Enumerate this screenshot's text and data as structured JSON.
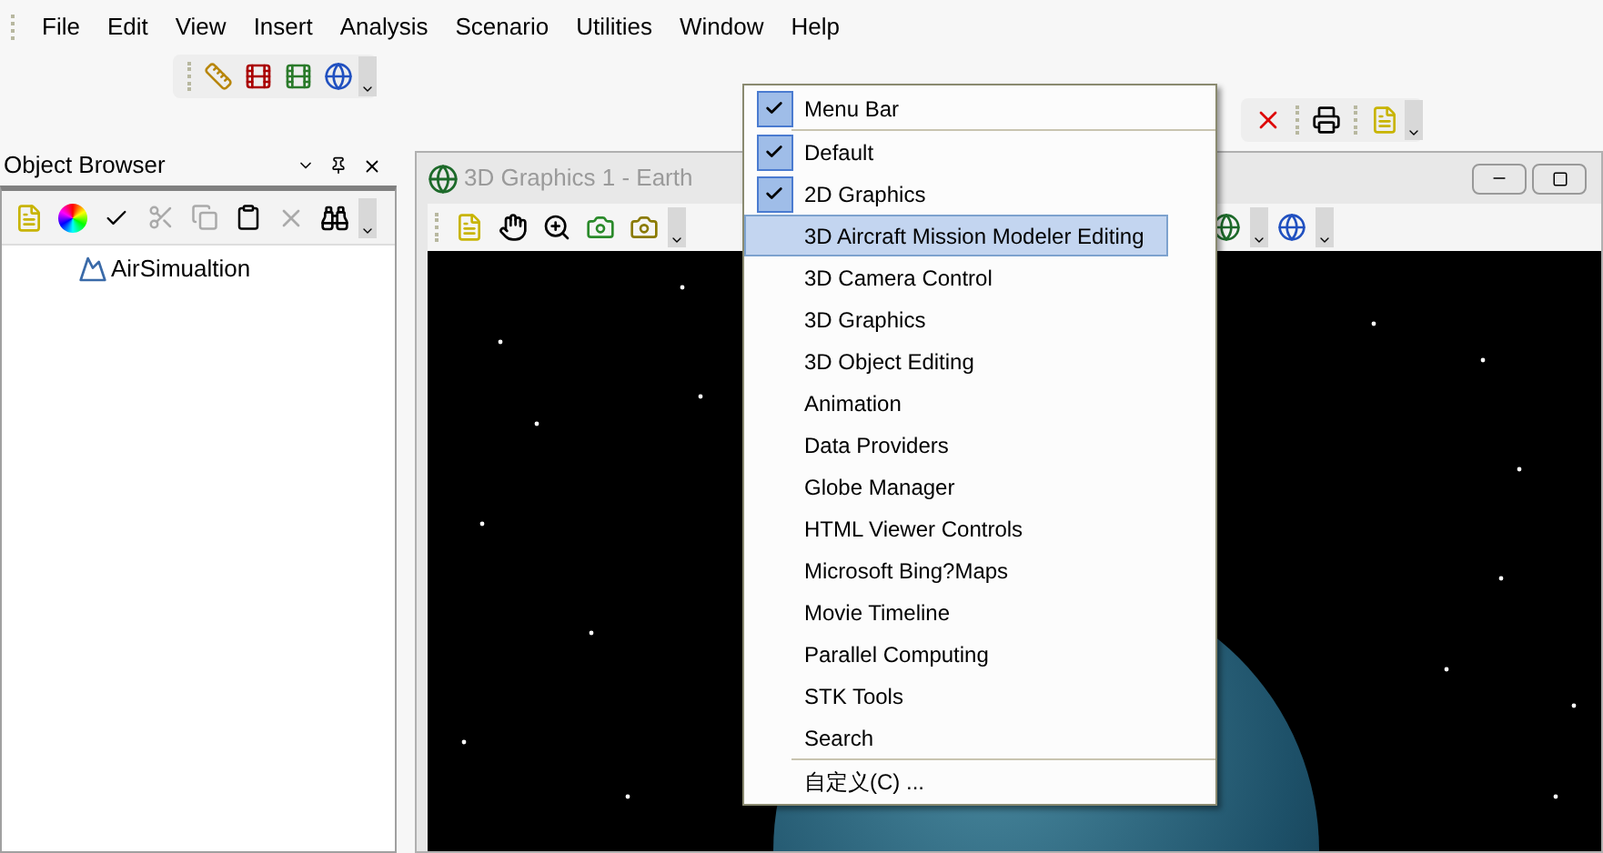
{
  "menu_bar": {
    "items": [
      {
        "label": "File"
      },
      {
        "label": "Edit"
      },
      {
        "label": "View"
      },
      {
        "label": "Insert"
      },
      {
        "label": "Analysis"
      },
      {
        "label": "Scenario"
      },
      {
        "label": "Utilities"
      },
      {
        "label": "Window"
      },
      {
        "label": "Help"
      }
    ]
  },
  "object_browser": {
    "title": "Object Browser",
    "tree": [
      {
        "label": "AirSimualtion"
      }
    ]
  },
  "graphics_window": {
    "title": "3D Graphics 1 - Earth"
  },
  "context_menu": {
    "sections": [
      {
        "items": [
          {
            "label": "Menu Bar",
            "checked": true,
            "selected": false
          }
        ]
      },
      {
        "items": [
          {
            "label": "Default",
            "checked": true,
            "selected": false
          },
          {
            "label": "2D Graphics",
            "checked": true,
            "selected": false
          },
          {
            "label": "3D Aircraft Mission Modeler Editing",
            "checked": false,
            "selected": true
          },
          {
            "label": "3D Camera Control",
            "checked": false,
            "selected": false
          },
          {
            "label": "3D Graphics",
            "checked": false,
            "selected": false
          },
          {
            "label": "3D Object Editing",
            "checked": false,
            "selected": false
          },
          {
            "label": "Animation",
            "checked": false,
            "selected": false
          },
          {
            "label": "Data Providers",
            "checked": false,
            "selected": false
          },
          {
            "label": "Globe Manager",
            "checked": false,
            "selected": false
          },
          {
            "label": "HTML Viewer Controls",
            "checked": false,
            "selected": false
          },
          {
            "label": "Microsoft Bing?Maps",
            "checked": false,
            "selected": false
          },
          {
            "label": "Movie Timeline",
            "checked": false,
            "selected": false
          },
          {
            "label": "Parallel Computing",
            "checked": false,
            "selected": false
          },
          {
            "label": "STK Tools",
            "checked": false,
            "selected": false
          },
          {
            "label": "Search",
            "checked": false,
            "selected": false
          }
        ]
      },
      {
        "items": [
          {
            "label": "自定义(C) ...",
            "checked": false,
            "selected": false
          }
        ]
      }
    ]
  }
}
